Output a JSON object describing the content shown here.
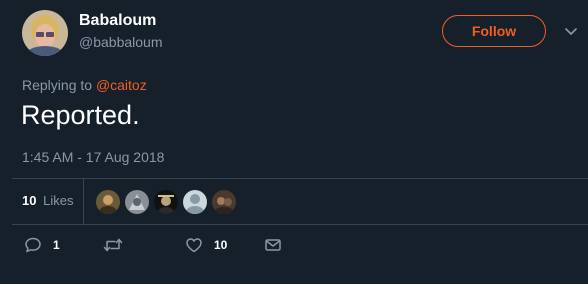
{
  "user": {
    "display_name": "Babaloum",
    "handle": "@babbaloum"
  },
  "follow_button": {
    "label": "Follow"
  },
  "tweet": {
    "replying_prefix": "Replying to",
    "replying_to": "@caitoz",
    "text": "Reported.",
    "timestamp": "1:45 AM - 17 Aug 2018"
  },
  "stats": {
    "likes_count": "10",
    "likes_label": "Likes"
  },
  "actions": {
    "reply_count": "1",
    "retweet_count": "",
    "like_count": "10"
  },
  "icons": [
    "caret-down-icon",
    "reply-icon",
    "retweet-icon",
    "heart-icon",
    "message-icon"
  ],
  "colors": {
    "background": "#15202b",
    "accent": "#f45d22",
    "secondary_text": "#8899a6",
    "divider": "#38444d"
  }
}
